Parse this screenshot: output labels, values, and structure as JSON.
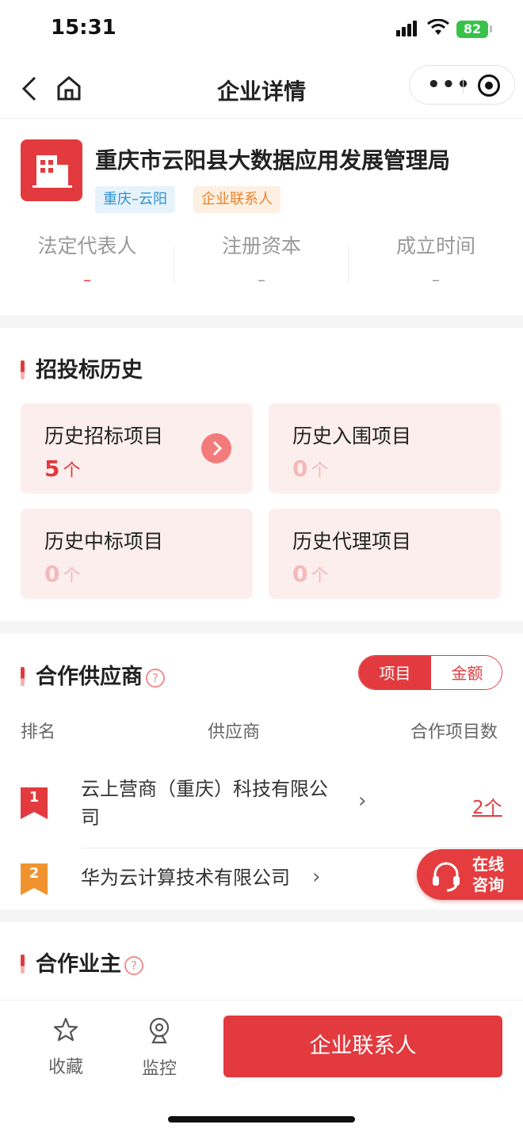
{
  "status_bar": {
    "time": "15:31",
    "battery": "82"
  },
  "nav": {
    "title": "企业详情"
  },
  "company": {
    "name": "重庆市云阳县大数据应用发展管理局",
    "tags": [
      "重庆–云阳",
      "企业联系人"
    ],
    "stats": [
      {
        "label": "法定代表人",
        "value": "–"
      },
      {
        "label": "注册资本",
        "value": "–"
      },
      {
        "label": "成立时间",
        "value": "–"
      }
    ]
  },
  "bidding": {
    "title": "招投标历史",
    "cards": [
      {
        "label": "历史招标项目",
        "count": "5",
        "unit": "个"
      },
      {
        "label": "历史入围项目",
        "count": "0",
        "unit": "个"
      },
      {
        "label": "历史中标项目",
        "count": "0",
        "unit": "个"
      },
      {
        "label": "历史代理项目",
        "count": "0",
        "unit": "个"
      }
    ]
  },
  "suppliers": {
    "title": "合作供应商",
    "toggle": [
      "项目",
      "金额"
    ],
    "headers": [
      "排名",
      "供应商",
      "合作项目数"
    ],
    "rows": [
      {
        "rank": "1",
        "name_line1": "云上营商（重庆）科技有限公",
        "name_line2": "司",
        "count": "2个"
      },
      {
        "rank": "2",
        "name": "华为云计算技术有限公司"
      }
    ]
  },
  "owners": {
    "title": "合作业主"
  },
  "float_button": {
    "line1": "在线",
    "line2": "咨询"
  },
  "bottom_bar": {
    "favorite": "收藏",
    "monitor": "监控",
    "cta": "企业联系人"
  },
  "colors": {
    "accent": "#e23a3e",
    "card_bg": "#fdeeee"
  }
}
